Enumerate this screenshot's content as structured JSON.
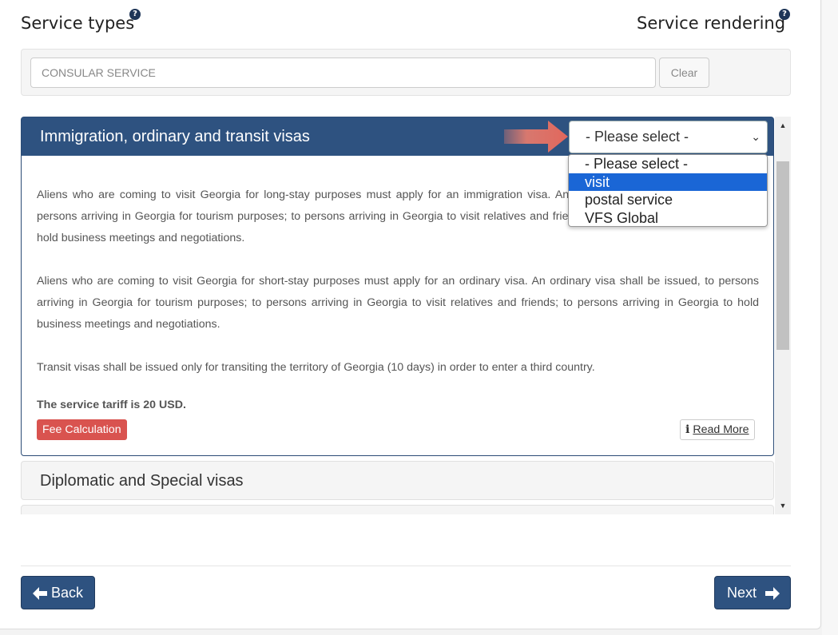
{
  "header": {
    "left_title": "Service types",
    "right_title": "Service rendering",
    "help_glyph": "?"
  },
  "search": {
    "value": "CONSULAR SERVICE",
    "clear_label": "Clear"
  },
  "panels": [
    {
      "title": "Immigration, ordinary and transit visas",
      "paragraphs": [
        "Aliens who are coming to visit Georgia for long-stay purposes must apply for an immigration visa. An immigration visa shall be issued, to persons arriving in Georgia for tourism purposes; to persons arriving in Georgia to visit relatives and friends; to persons arriving in Georgia to hold business meetings and negotiations.",
        "Aliens who are coming to visit Georgia for short-stay purposes must apply for an ordinary visa. An ordinary visa shall be issued, to persons arriving in Georgia for tourism purposes; to persons arriving in Georgia to visit relatives and friends; to persons arriving in Georgia to hold business meetings and negotiations.",
        "Transit visas shall be issued only for transiting the territory of Georgia (10 days) in order to enter a third country."
      ],
      "tariff": "The service tariff is 20 USD.",
      "fee_label": "Fee Calculation",
      "read_more_icon": "i",
      "read_more_label": "Read More"
    },
    {
      "title": "Diplomatic and Special visas"
    }
  ],
  "select": {
    "value": "- Please select -",
    "chevron": "⌄",
    "options": [
      "- Please select -",
      "visit",
      "postal service",
      "VFS Global"
    ],
    "highlighted": "visit"
  },
  "footer": {
    "back_label": "Back",
    "next_label": "Next"
  },
  "colors": {
    "panel_header": "#2e5280",
    "fee_button": "#d9534f",
    "option_highlight": "#1a66d6",
    "annotation_arrow": "#e07a6e"
  },
  "icons": {
    "annotation": "right-arrow-icon",
    "back": "arrow-left-icon",
    "next": "arrow-right-icon"
  }
}
